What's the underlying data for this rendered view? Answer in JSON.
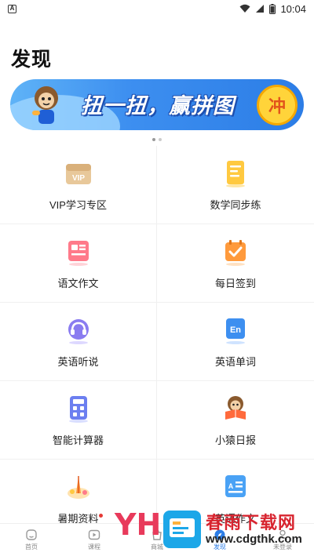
{
  "status": {
    "time": "10:04",
    "app_icon": "A"
  },
  "page": {
    "title": "发现"
  },
  "banner": {
    "text": "扭一扭，赢拼图",
    "button": "冲",
    "slides": 2,
    "active_slide": 0
  },
  "features": [
    {
      "label": "VIP学习专区",
      "icon": "vip-icon"
    },
    {
      "label": "数学同步练",
      "icon": "math-practice-icon"
    },
    {
      "label": "语文作文",
      "icon": "chinese-essay-icon"
    },
    {
      "label": "每日签到",
      "icon": "daily-checkin-icon"
    },
    {
      "label": "英语听说",
      "icon": "english-listening-icon"
    },
    {
      "label": "英语单词",
      "icon": "english-words-icon"
    },
    {
      "label": "智能计算器",
      "icon": "calculator-icon"
    },
    {
      "label": "小猿日报",
      "icon": "daily-news-icon"
    },
    {
      "label": "暑期资料",
      "icon": "summer-materials-icon",
      "badge": true
    },
    {
      "label": "英语作文",
      "icon": "english-essay-icon"
    }
  ],
  "tabbar": [
    {
      "label": "首页",
      "icon": "home-icon"
    },
    {
      "label": "课程",
      "icon": "course-icon"
    },
    {
      "label": "商城",
      "icon": "mall-icon"
    },
    {
      "label": "发现",
      "icon": "discover-icon",
      "active": true
    },
    {
      "label": "未登录",
      "icon": "profile-icon"
    }
  ],
  "watermark": {
    "logo": "YH",
    "title": "春雨下载网",
    "url": "www.cdgthk.com"
  },
  "colors": {
    "accent": "#2c7de6",
    "banner_yellow": "#ffd43a",
    "watermark_red": "#d8242f"
  }
}
